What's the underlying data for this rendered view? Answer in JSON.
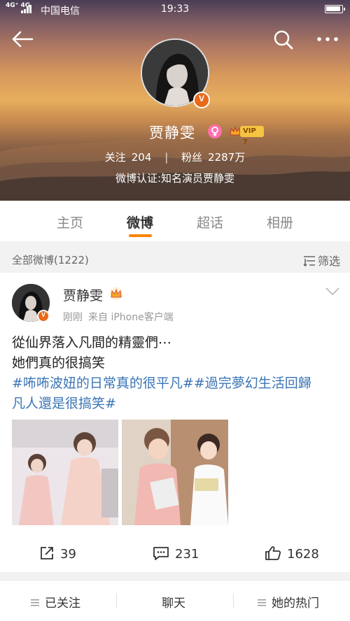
{
  "status_bar": {
    "network": "4G⁺ 4G",
    "carrier": "中国电信",
    "time": "19:33"
  },
  "header": {
    "back_icon": "back-arrow-icon",
    "search_icon": "search-icon",
    "more_icon": "more-dots-icon"
  },
  "profile": {
    "name": "贾静雯",
    "gender_icon": "female-icon",
    "vip_label": "VIP 7",
    "following_label": "关注",
    "following_count": "204",
    "followers_label": "粉丝",
    "followers_count": "2287万",
    "verification": "微博认证:知名演员贾静雯"
  },
  "tabs": [
    {
      "label": "主页",
      "active": false
    },
    {
      "label": "微博",
      "active": true
    },
    {
      "label": "超话",
      "active": false
    },
    {
      "label": "相册",
      "active": false
    }
  ],
  "filter_bar": {
    "all_posts": "全部微博(1222)",
    "filter_label": "筛选"
  },
  "post": {
    "author": "贾静雯",
    "time": "刚刚",
    "source": "来自 iPhone客户端",
    "text_lines": [
      "從仙界落入凡間的精靈們⋯",
      "她們真的很搞笑"
    ],
    "topic_lines": [
      "#咘咘波妞的日常真的很平凡##過完夢幻生活回歸",
      "凡人還是很搞笑#"
    ],
    "reposts": "39",
    "comments": "231",
    "likes": "1628"
  },
  "bottom_bar": {
    "followed": "已关注",
    "chat": "聊天",
    "hot": "她的热门"
  },
  "colors": {
    "accent": "#ff8200",
    "topic_link": "#3a74b5",
    "verified": "#e86a1a",
    "vip_gold": "#f6c343"
  }
}
